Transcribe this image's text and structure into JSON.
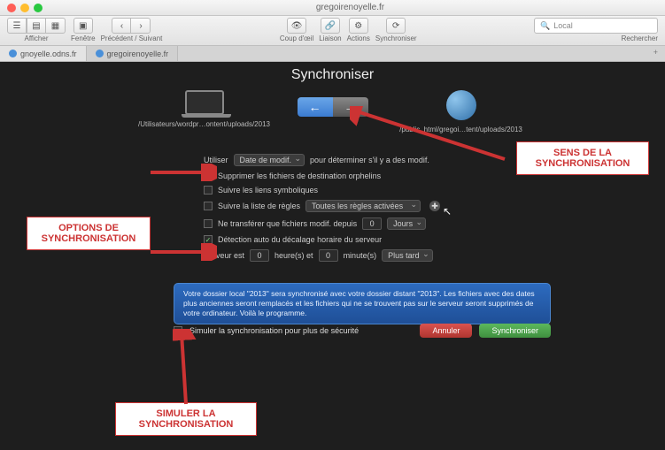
{
  "window": {
    "title": "gregoirenoyelle.fr"
  },
  "toolbar": {
    "afficher": "Afficher",
    "fenetre": "Fenêtre",
    "nav": "Précédent / Suivant",
    "coup": "Coup d'œil",
    "liaison": "Liaison",
    "actions": "Actions",
    "sync": "Synchroniser",
    "search_placeholder": "Rechercher",
    "search_scope": "Local"
  },
  "tabs": {
    "items": [
      "gnoyelle.odns.fr",
      "gregoirenoyelle.fr"
    ]
  },
  "panel": {
    "title": "Synchroniser",
    "local_path": "/Utilisateurs/wordpr…ontent/uploads/2013",
    "remote_path": "/public_html/gregoi…tent/uploads/2013"
  },
  "opts": {
    "utiliser": "Utiliser",
    "utiliser_sel": "Date de modif.",
    "utiliser_suffix": "pour déterminer s'il y a des modif.",
    "supprimer": "Supprimer les fichiers de destination orphelins",
    "liens": "Suivre les liens symboliques",
    "regles": "Suivre la liste de règles",
    "regles_sel": "Toutes les règles activées",
    "netransf": "Ne transférer que fichiers modif. depuis",
    "netransf_val": "0",
    "netransf_unit": "Jours",
    "detection": "Détection auto du décalage horaire du serveur",
    "serveur": "Serveur est",
    "h": "0",
    "hlabel": "heure(s) et",
    "m": "0",
    "mlabel": "minute(s)",
    "dir": "Plus tard"
  },
  "notice": {
    "text": "Votre dossier local \"2013\" sera synchronisé avec votre dossier distant \"2013\". Les fichiers avec des dates plus anciennes seront remplacés et les fichiers qui ne se trouvent pas sur le serveur seront supprimés de votre ordinateur. Voilà le programme."
  },
  "bottom": {
    "simulate": "Simuler la synchronisation pour plus de sécurité",
    "cancel": "Annuler",
    "go": "Synchroniser"
  },
  "callouts": {
    "sens": "SENS DE LA\nSYNCHRONISATION",
    "options": "OPTIONS DE\nSYNCHRONISATION",
    "simuler": "SIMULER LA\nSYNCHRONISATION"
  }
}
